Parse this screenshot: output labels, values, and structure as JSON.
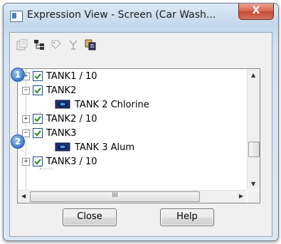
{
  "window": {
    "title": "Expression View - Screen (Car Wash...",
    "close_glyph": "X"
  },
  "toolbar": {
    "icons": [
      "properties-icon",
      "tree-structure-icon",
      "tag-icon",
      "filter-icon",
      "copy-icon"
    ]
  },
  "tree": {
    "nodes": [
      {
        "label": "TANK1 / 10",
        "expander": "+",
        "checked": true
      },
      {
        "label": "TANK2",
        "expander": "−",
        "checked": true
      },
      {
        "label": "TANK 2 Chlorine",
        "leaf": true
      },
      {
        "label": "TANK2 / 10",
        "expander": "+",
        "checked": true
      },
      {
        "label": "TANK3",
        "expander": "−",
        "checked": true
      },
      {
        "label": "TANK 3 Alum",
        "leaf": true
      },
      {
        "label": "TANK3 / 10",
        "expander": "+",
        "checked": true
      }
    ],
    "hscroll_grip": "III"
  },
  "callouts": [
    "1",
    "2"
  ],
  "buttons": {
    "close_label": "Close",
    "help_label": "Help"
  },
  "colors": {
    "check": "#2f8f2a",
    "callout": "#3c78c9",
    "close_button": "#c24a32"
  }
}
